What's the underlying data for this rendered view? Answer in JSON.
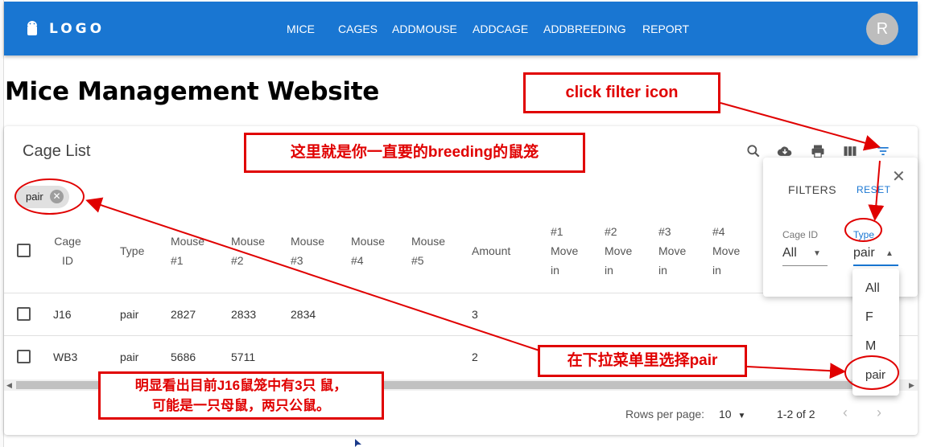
{
  "appbar": {
    "logo": "LOGO",
    "avatar_initial": "R",
    "nav": [
      "MICE",
      "CAGES",
      "ADDMOUSE",
      "ADDCAGE",
      "ADDBREEDING",
      "REPORT"
    ]
  },
  "page_title": "Mice Management Website",
  "card": {
    "title": "Cage List",
    "toolbar_icons": [
      "search-icon",
      "download-icon",
      "print-icon",
      "view-columns-icon",
      "filter-icon"
    ],
    "chip": "pair",
    "columns": [
      [
        "Cage",
        "ID"
      ],
      [
        "Type"
      ],
      [
        "Mouse",
        "#1"
      ],
      [
        "Mouse",
        "#2"
      ],
      [
        "Mouse",
        "#3"
      ],
      [
        "Mouse",
        "#4"
      ],
      [
        "Mouse",
        "#5"
      ],
      [
        "Amount"
      ],
      [
        "#1",
        "Move",
        "in"
      ],
      [
        "#2",
        "Move",
        "in"
      ],
      [
        "#3",
        "Move",
        "in"
      ],
      [
        "#4",
        "Move",
        "in"
      ]
    ],
    "rows": [
      {
        "cage_id": "J16",
        "type": "pair",
        "m1": "2827",
        "m2": "2833",
        "m3": "2834",
        "m4": "",
        "m5": "",
        "amount": "3"
      },
      {
        "cage_id": "WB3",
        "type": "pair",
        "m1": "5686",
        "m2": "5711",
        "m3": "",
        "m4": "",
        "m5": "",
        "amount": "2"
      }
    ],
    "footer": {
      "rows_per_page_label": "Rows per page:",
      "rows_per_page": "10",
      "range": "1-2 of 2"
    }
  },
  "filters": {
    "title": "FILTERS",
    "reset": "RESET",
    "cage_id_label": "Cage ID",
    "cage_id_value": "All",
    "type_label": "Type",
    "type_value": "pair",
    "type_options": [
      "All",
      "F",
      "M",
      "pair"
    ]
  },
  "annotations": {
    "click_filter": "click filter icon",
    "breeding_note": "这里就是你一直要的breeding的鼠笼",
    "select_pair": "在下拉菜单里选择pair",
    "j16_note_line1": "明显看出目前J16鼠笼中有3只 鼠，",
    "j16_note_line2": "可能是一只母鼠，两只公鼠。"
  },
  "colors": {
    "primary": "#1976d2",
    "annotation_red": "#e00000"
  }
}
